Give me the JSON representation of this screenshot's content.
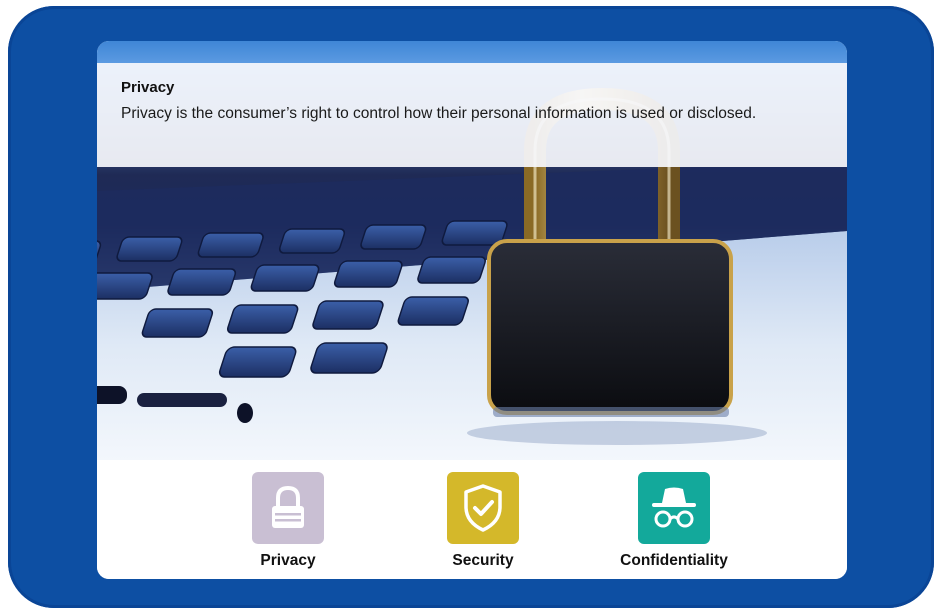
{
  "info": {
    "title": "Privacy",
    "text": "Privacy is the consumer’s right to control how their personal information is used or disclosed."
  },
  "tiles": [
    {
      "label": "Privacy",
      "icon": "padlock-icon",
      "color": "#c9bfd3"
    },
    {
      "label": "Security",
      "icon": "shield-check-icon",
      "color": "#d4b82a"
    },
    {
      "label": "Confidentiality",
      "icon": "incognito-icon",
      "color": "#13a99b"
    }
  ],
  "colors": {
    "frame": "#0d4fa3",
    "card": "#ffffff"
  }
}
